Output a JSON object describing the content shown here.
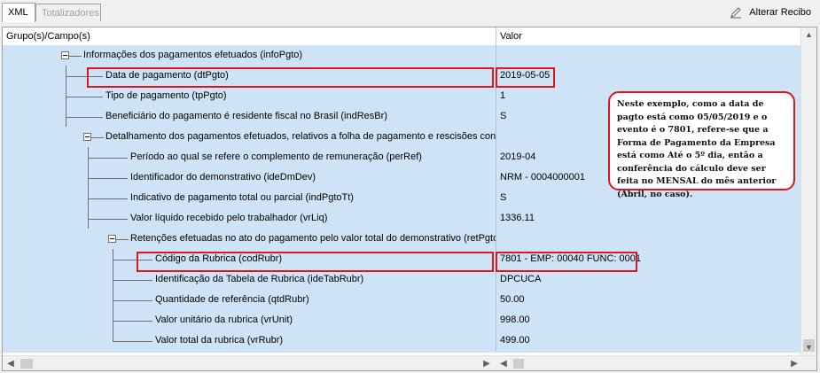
{
  "tabs": [
    {
      "label": "XML",
      "active": true
    },
    {
      "label": "Totalizadores",
      "active": false
    }
  ],
  "toolbar": {
    "alter_label": "Alterar Recibo",
    "alter_icon": "pencil-icon"
  },
  "grid": {
    "columns": [
      "Grupo(s)/Campo(s)",
      "Valor"
    ],
    "rows": [
      {
        "label": "Informações dos pagamentos efetuados (infoPgto)",
        "value": "",
        "level": 0,
        "expander": true
      },
      {
        "label": "Data de pagamento (dtPgto)",
        "value": "2019-05-05",
        "level": 1
      },
      {
        "label": "Tipo de pagamento (tpPgto)",
        "value": "1",
        "level": 1
      },
      {
        "label": "Beneficiário do pagamento é residente fiscal no Brasil (indResBr)",
        "value": "S",
        "level": 1
      },
      {
        "label": "Detalhamento dos pagamentos efetuados, relativos a folha de pagamento e rescisões contr",
        "value": "",
        "level": 1,
        "expander": true
      },
      {
        "label": "Período ao qual se refere o complemento de remuneração (perRef)",
        "value": "2019-04",
        "level": 2
      },
      {
        "label": "Identificador do demonstrativo (ideDmDev)",
        "value": "NRM - 0004000001",
        "level": 2
      },
      {
        "label": "Indicativo de pagamento total ou parcial (indPgtoTt)",
        "value": "S",
        "level": 2
      },
      {
        "label": "Valor líquido recebido pelo trabalhador (vrLiq)",
        "value": "1336.11",
        "level": 2
      },
      {
        "label": "Retenções efetuadas no ato do pagamento pelo valor total do demonstrativo (retPgtoT",
        "value": "",
        "level": 2,
        "expander": true
      },
      {
        "label": "Código da Rubrica (codRubr)",
        "value": "7801 - EMP: 00040 FUNC: 0001",
        "level": 3
      },
      {
        "label": "Identificação da Tabela de Rubrica (ideTabRubr)",
        "value": "DPCUCA",
        "level": 3
      },
      {
        "label": "Quantidade de referência (qtdRubr)",
        "value": "50.00",
        "level": 3
      },
      {
        "label": "Valor unitário da rubrica (vrUnit)",
        "value": "998.00",
        "level": 3
      },
      {
        "label": "Valor total da rubrica (vrRubr)",
        "value": "499.00",
        "level": 3
      }
    ]
  },
  "callout": {
    "text": "Neste exemplo, como a data de pagto está como 05/05/2019 e o evento é o 7801, refere-se que a Forma de Pagamento da Empresa está como Até o 5º dia, então a conferência do cálculo deve ser feita no MENSAL do mês anterior (Abril, no caso)."
  },
  "colors": {
    "selection": "#cfe3f6",
    "highlight": "#e0141e"
  }
}
